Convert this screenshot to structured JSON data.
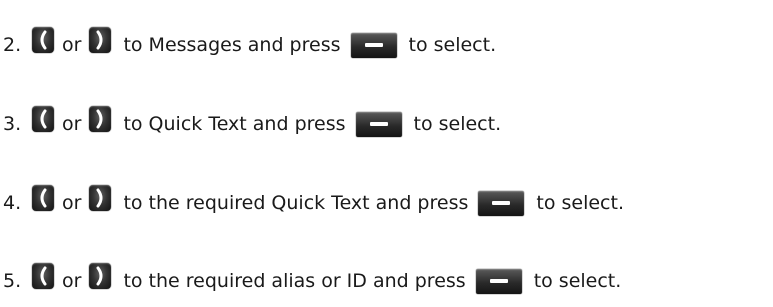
{
  "steps": [
    {
      "number": "2.",
      "connector": "or",
      "action": "to Messages and press",
      "suffix": "to select."
    },
    {
      "number": "3.",
      "connector": "or",
      "action": "to Quick Text and press",
      "suffix": "to select."
    },
    {
      "number": "4.",
      "connector": "or",
      "action": "to the required Quick Text and press",
      "suffix": "to select."
    },
    {
      "number": "5.",
      "connector": "or",
      "action": "to the required alias or ID and press",
      "suffix": "to select."
    }
  ],
  "icons": {
    "left_key": "left-navigation-key-icon",
    "right_key": "right-navigation-key-icon",
    "select_key": "select-softkey-icon"
  },
  "colors": {
    "text": "#1a1a1a",
    "key_body": "#333333",
    "key_glyph": "#ffffff"
  }
}
